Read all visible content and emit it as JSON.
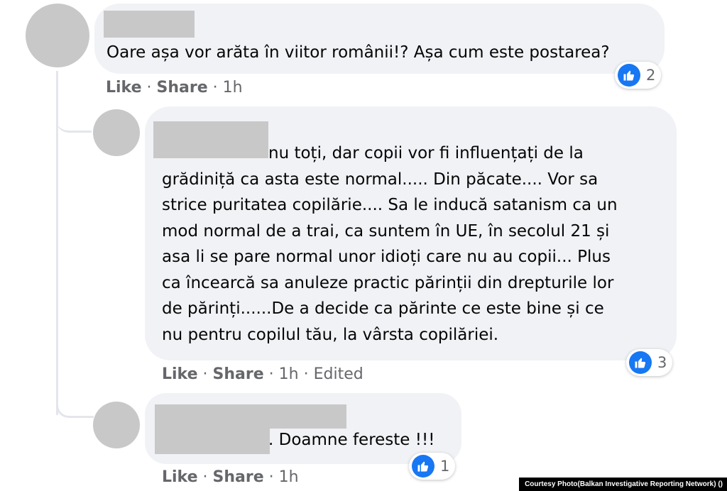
{
  "comments": [
    {
      "text_lines": [
        "Oare așa vor arăta în viitor românii!? Așa cum este postarea?"
      ],
      "actions": {
        "like": "Like",
        "share": "Share",
        "time": "1h"
      },
      "reaction_count": "2"
    },
    {
      "text_lines": [
        "nu toți, dar copii vor fi influențați de la",
        "grădiniță ca asta este normal..... Din păcate.... Vor sa",
        "strice puritatea copilărie.... Sa le inducă satanism ca un",
        "mod normal de a trai, ca suntem în UE, în secolul 21 și",
        "asa li se pare normal unor idioți care nu au copii... Plus",
        "ca încearcă sa anuleze practic părinții din drepturile lor",
        "de părinți......De a decide ca părinte ce este bine și ce",
        "nu pentru copilul tău, la vârsta copilăriei."
      ],
      "actions": {
        "like": "Like",
        "share": "Share",
        "time": "1h",
        "edited": "Edited"
      },
      "reaction_count": "3"
    },
    {
      "text_lines": [
        ". Doamne fereste !!!"
      ],
      "actions": {
        "like": "Like",
        "share": "Share",
        "time": "1h"
      },
      "reaction_count": "1"
    }
  ],
  "separator": "·",
  "colors": {
    "bubble": "#f0f2f5",
    "like_blue": "#1877f2",
    "meta_gray": "#65676b",
    "redaction": "#c8c8c8"
  },
  "icons": {
    "reaction": "thumbs-up-icon"
  },
  "credit": "Courtesy Photo(Balkan Investigative Reporting Network) ()"
}
